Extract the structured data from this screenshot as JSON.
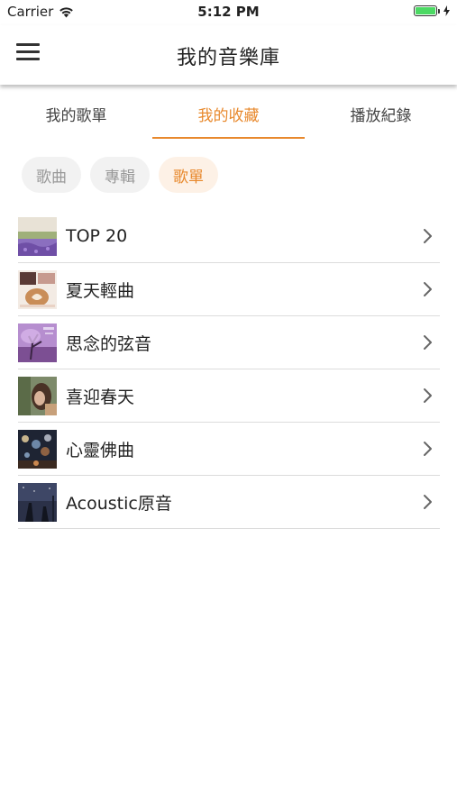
{
  "status": {
    "carrier": "Carrier",
    "time": "5:12 PM",
    "battery_level": 1.0,
    "battery_color": "#4cd964"
  },
  "nav": {
    "title": "我的音樂庫",
    "menu_icon": "hamburger-menu-icon"
  },
  "tabs": [
    {
      "label": "我的歌單",
      "active": false
    },
    {
      "label": "我的收藏",
      "active": true
    },
    {
      "label": "播放紀錄",
      "active": false
    }
  ],
  "chips": [
    {
      "label": "歌曲",
      "active": false
    },
    {
      "label": "專輯",
      "active": false
    },
    {
      "label": "歌單",
      "active": true
    }
  ],
  "playlists": [
    {
      "title": "TOP 20"
    },
    {
      "title": "夏天輕曲"
    },
    {
      "title": "思念的弦音"
    },
    {
      "title": "喜迎春天"
    },
    {
      "title": "心靈佛曲"
    },
    {
      "title": "Acoustic原音"
    }
  ],
  "colors": {
    "accent": "#e8892d",
    "chip_bg": "#f2f2f2",
    "chip_active_bg": "#fdf1e6"
  }
}
